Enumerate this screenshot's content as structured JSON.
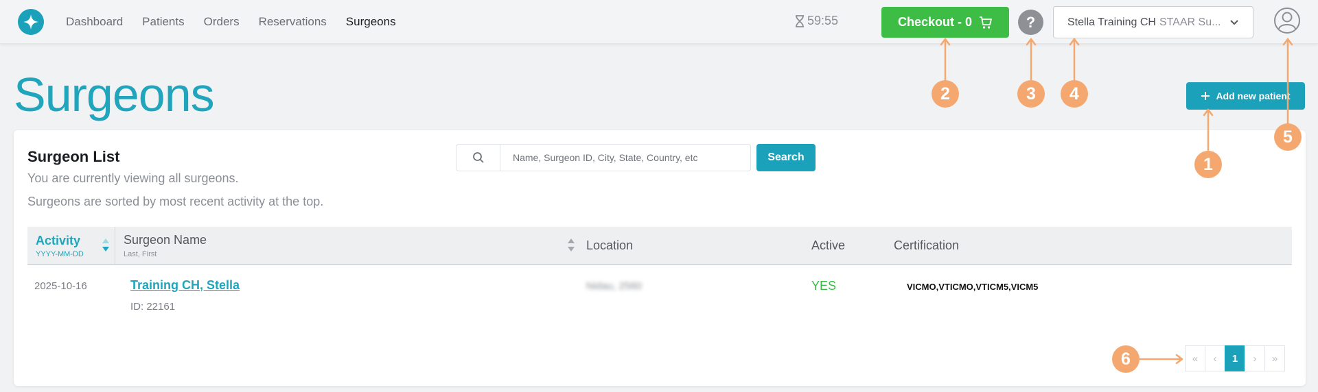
{
  "nav": {
    "items": [
      {
        "label": "Dashboard"
      },
      {
        "label": "Patients"
      },
      {
        "label": "Orders"
      },
      {
        "label": "Reservations"
      },
      {
        "label": "Surgeons"
      }
    ],
    "active_index": 4
  },
  "header": {
    "timer": "59:55",
    "checkout_label": "Checkout - 0",
    "help_label": "?",
    "account_name": "Stella Training CH",
    "account_org": "STAAR Su..."
  },
  "page": {
    "title": "Surgeons",
    "add_button_label": "Add new patient"
  },
  "surgeon_list": {
    "title": "Surgeon List",
    "subtitle_1": "You are currently viewing all surgeons.",
    "subtitle_2": "Surgeons are sorted by most recent activity at the top.",
    "search_placeholder": "Name, Surgeon ID, City, State, Country, etc",
    "search_button": "Search"
  },
  "table": {
    "columns": {
      "activity": "Activity",
      "activity_format": "YYYY-MM-DD",
      "surgeon_name": "Surgeon Name",
      "surgeon_name_format": "Last, First",
      "location": "Location",
      "active": "Active",
      "certification": "Certification"
    },
    "rows": [
      {
        "activity": "2025-10-16",
        "name": "Training CH, Stella",
        "id": "ID: 22161",
        "location": "Nidau, 2560",
        "active": "YES",
        "certification": "VICMO,VTICMO,VTICM5,VICM5"
      }
    ]
  },
  "pagination": {
    "first": "«",
    "prev": "‹",
    "current": "1",
    "next": "›",
    "last": "»"
  },
  "callouts": [
    "1",
    "2",
    "3",
    "4",
    "5",
    "6"
  ],
  "colors": {
    "brand_teal": "#1ba1b9",
    "checkout_green": "#3dbd45",
    "callout_orange": "#f4a76e",
    "active_green": "#3dbd45"
  },
  "icons": [
    "star-logo-icon",
    "hourglass-icon",
    "cart-icon",
    "question-icon",
    "chevron-down-icon",
    "user-circle-icon",
    "plus-icon",
    "search-icon",
    "sort-icon"
  ]
}
